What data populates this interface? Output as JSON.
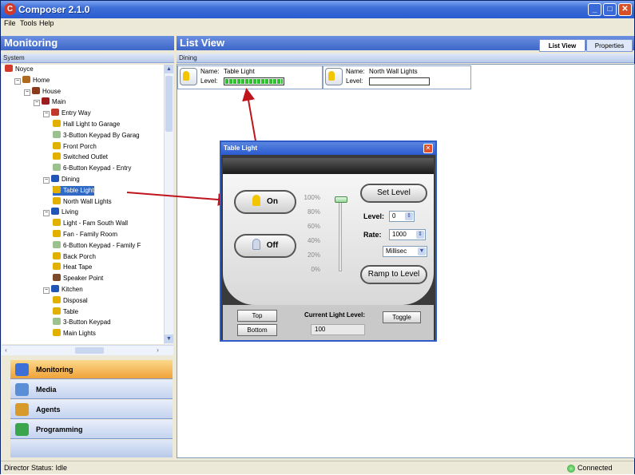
{
  "window": {
    "title": "Composer 2.1.0"
  },
  "menu": [
    "File",
    "Tools",
    "Help"
  ],
  "left_panel": {
    "title": "Monitoring",
    "subheader": "System"
  },
  "tree": [
    {
      "label": "Noyce",
      "indent": 0,
      "color": "#d23b2b"
    },
    {
      "label": "Home",
      "indent": 1,
      "color": "#b06a1e",
      "expander": "⊟"
    },
    {
      "label": "House",
      "indent": 2,
      "color": "#8b3b1c",
      "expander": "⊟"
    },
    {
      "label": "Main",
      "indent": 3,
      "color": "#9b1d1d",
      "expander": "⊟"
    },
    {
      "label": "Entry Way",
      "indent": 4,
      "color": "#c0392b",
      "expander": "⊟"
    },
    {
      "label": "Hall Light to Garage",
      "indent": 5,
      "color": "#e2b100"
    },
    {
      "label": "3-Button Keypad By Garag",
      "indent": 5,
      "color": "#9bc18e"
    },
    {
      "label": "Front Porch",
      "indent": 5,
      "color": "#e2b100"
    },
    {
      "label": "Switched Outlet",
      "indent": 5,
      "color": "#e2b100"
    },
    {
      "label": "6-Button Keypad - Entry",
      "indent": 5,
      "color": "#9bc18e"
    },
    {
      "label": "Dining",
      "indent": 4,
      "color": "#2155b8",
      "expander": "⊟"
    },
    {
      "label": "Table Light",
      "indent": 5,
      "color": "#e2b100",
      "selected": true
    },
    {
      "label": "North Wall Lights",
      "indent": 5,
      "color": "#e2b100"
    },
    {
      "label": "Living",
      "indent": 4,
      "color": "#2155b8",
      "expander": "⊟"
    },
    {
      "label": "Light - Fam South Wall",
      "indent": 5,
      "color": "#e2b100"
    },
    {
      "label": "Fan - Family Room",
      "indent": 5,
      "color": "#e2b100"
    },
    {
      "label": "6-Button Keypad - Family F",
      "indent": 5,
      "color": "#9bc18e"
    },
    {
      "label": "Back Porch",
      "indent": 5,
      "color": "#e2b100"
    },
    {
      "label": "Heat Tape",
      "indent": 5,
      "color": "#e2b100"
    },
    {
      "label": "Speaker Point",
      "indent": 5,
      "color": "#7a4a2a"
    },
    {
      "label": "Kitchen",
      "indent": 4,
      "color": "#2155b8",
      "expander": "⊟"
    },
    {
      "label": "Disposal",
      "indent": 5,
      "color": "#e2b100"
    },
    {
      "label": "Table",
      "indent": 5,
      "color": "#e2b100"
    },
    {
      "label": "3-Button Keypad",
      "indent": 5,
      "color": "#9bc18e"
    },
    {
      "label": "Main Lights",
      "indent": 5,
      "color": "#e2b100"
    }
  ],
  "nav": [
    {
      "label": "Monitoring",
      "active": true,
      "color": "#3d6fd8"
    },
    {
      "label": "Media",
      "active": false,
      "color": "#5a8fd8"
    },
    {
      "label": "Agents",
      "active": false,
      "color": "#d89a2a"
    },
    {
      "label": "Programming",
      "active": false,
      "color": "#3aa54a"
    }
  ],
  "list_view": {
    "title": "List View",
    "subheader": "Dining",
    "tabs": [
      "List View",
      "Properties"
    ],
    "cards": [
      {
        "name_label": "Name:",
        "name": "Table Light",
        "level_label": "Level:",
        "level": 1.0
      },
      {
        "name_label": "Name:",
        "name": "North Wall Lights",
        "level_label": "Level:",
        "level": 0.0
      }
    ]
  },
  "dialog": {
    "title": "Table Light",
    "close_glyph": "✕",
    "on_label": "On",
    "off_label": "Off",
    "scale": [
      "100%",
      "80%",
      "60%",
      "40%",
      "20%",
      "0%"
    ],
    "set_level_label": "Set Level",
    "level_label": "Level:",
    "level_value": "0",
    "rate_label": "Rate:",
    "rate_value": "1000",
    "unit_value": "Millisec",
    "ramp_label": "Ramp to Level",
    "top_label": "Top",
    "bottom_label": "Bottom",
    "current_label": "Current Light Level:",
    "current_value": "100",
    "toggle_label": "Toggle",
    "slider_value": 1.0
  },
  "status": {
    "director": "Director Status: Idle",
    "connection": "Connected"
  }
}
